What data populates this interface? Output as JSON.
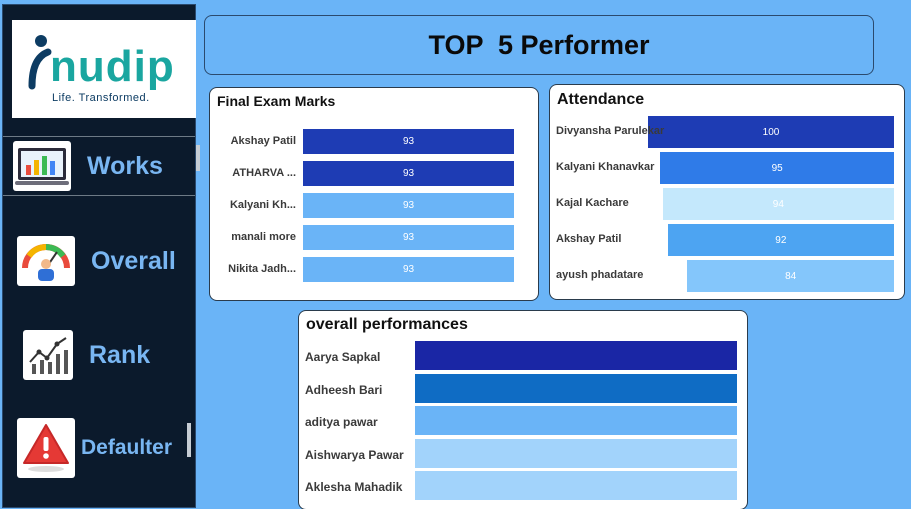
{
  "sidebar": {
    "logo": {
      "brand": "nudip",
      "tagline": "Life. Transformed."
    },
    "items": [
      {
        "label": "Works",
        "icon": "works-chart-icon"
      },
      {
        "label": "Overall",
        "icon": "gauge-icon"
      },
      {
        "label": "Rank",
        "icon": "rank-chart-icon"
      },
      {
        "label": "Defaulter",
        "icon": "warning-icon"
      }
    ]
  },
  "title": "TOP  5 Performer",
  "final_exam": {
    "title": "Final Exam Marks",
    "rows": [
      {
        "name": "Akshay Patil",
        "value": 93,
        "value_label": "93",
        "color": "#1e3cb4"
      },
      {
        "name": "ATHARVA ...",
        "value": 93,
        "value_label": "93",
        "color": "#1e3cb4"
      },
      {
        "name": "Kalyani Kh...",
        "value": 93,
        "value_label": "93",
        "color": "#6ab4f7"
      },
      {
        "name": "manali more",
        "value": 93,
        "value_label": "93",
        "color": "#6ab4f7"
      },
      {
        "name": "Nikita Jadh...",
        "value": 93,
        "value_label": "93",
        "color": "#6ab4f7"
      }
    ]
  },
  "attendance": {
    "title": "Attendance",
    "rows": [
      {
        "name": "Divyansha Parulekar",
        "value": 100,
        "value_label": "100",
        "color": "#1e3cb4"
      },
      {
        "name": "Kalyani Khanavkar",
        "value": 95,
        "value_label": "95",
        "color": "#2f7be8"
      },
      {
        "name": "Kajal Kachare",
        "value": 94,
        "value_label": "94",
        "color": "#c4e8fc"
      },
      {
        "name": "Akshay Patil",
        "value": 92,
        "value_label": "92",
        "color": "#4da4f2"
      },
      {
        "name": "ayush phadatare",
        "value": 84,
        "value_label": "84",
        "color": "#84c6fb"
      }
    ]
  },
  "overall_performances": {
    "title": "overall performances",
    "rows": [
      {
        "name": "Aarya Sapkal",
        "color": "#1a26a5"
      },
      {
        "name": "Adheesh Bari",
        "color": "#0f6cc4"
      },
      {
        "name": "aditya pawar",
        "color": "#6ab4f7"
      },
      {
        "name": "Aishwarya Pawar",
        "color": "#a2d3fb"
      },
      {
        "name": "Aklesha Mahadik",
        "color": "#a2d3fb"
      }
    ]
  }
}
